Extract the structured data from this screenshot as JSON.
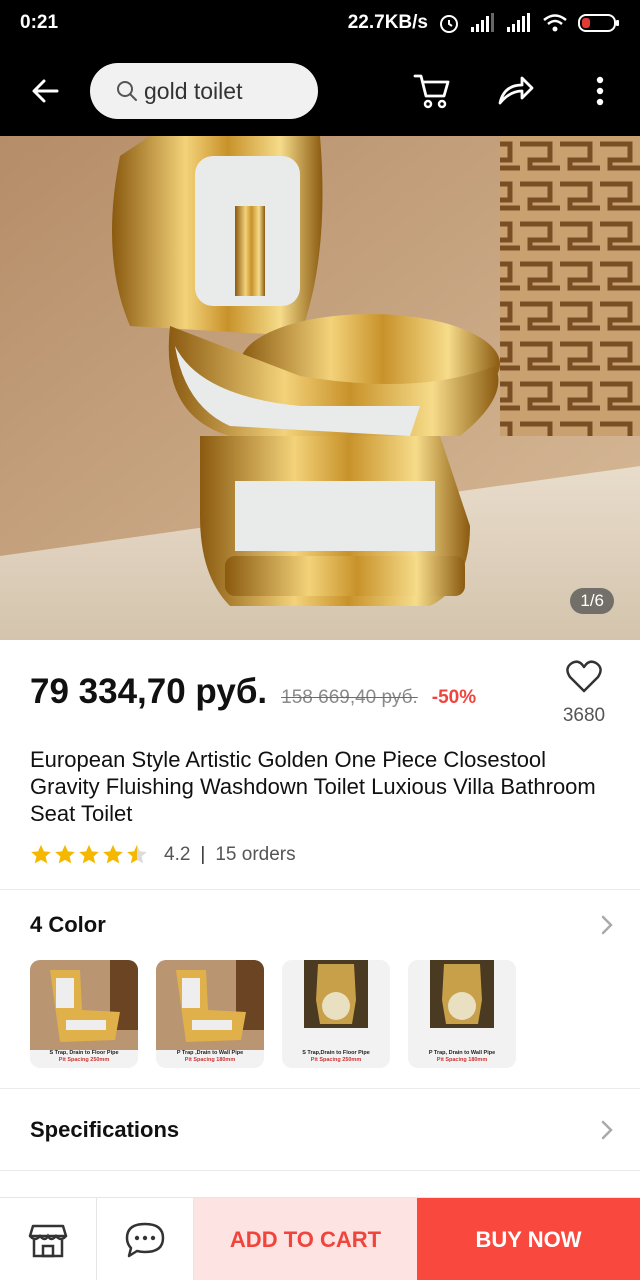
{
  "status_bar": {
    "time": "0:21",
    "network_speed": "22.7KB/s",
    "icons": [
      "alarm-icon",
      "signal-icon",
      "signal-icon",
      "wifi-icon",
      "battery-icon"
    ]
  },
  "header": {
    "search_query": "gold toilet",
    "icons": [
      "back-arrow-icon",
      "search-icon",
      "cart-icon",
      "share-icon",
      "more-vertical-icon"
    ]
  },
  "gallery": {
    "counter": "1/6"
  },
  "product": {
    "price": "79 334,70 руб.",
    "old_price": "158 669,40 руб.",
    "discount": "-50%",
    "wishlist_count": "3680",
    "title": "European Style Artistic Golden One Piece Closestool Gravity Fluishing Washdown Toilet Luxious Villa Bathroom Seat Toilet",
    "rating": 4.2,
    "rating_text": "4.2",
    "orders": "15 orders",
    "colors": {
      "accent": "#f0443c",
      "star": "#f5b800"
    }
  },
  "color_section": {
    "title": "4 Color",
    "options": [
      {
        "line1": "S Trap, Drain to Floor Pipe",
        "line2": "Pit Spacing 250mm"
      },
      {
        "line1": "P Trap ,Drain to Wall Pipe",
        "line2": "Pit Spacing 180mm"
      },
      {
        "line1": "S Trap,Drain to Floor Pipe",
        "line2": "Pit Spacing 250mm"
      },
      {
        "line1": "P Trap, Drain to Wall Pipe",
        "line2": "Pit Spacing 180mm"
      }
    ]
  },
  "specifications": {
    "title": "Specifications"
  },
  "bottom_bar": {
    "add_to_cart": "ADD TO CART",
    "buy_now": "BUY NOW",
    "icons": [
      "store-icon",
      "chat-icon"
    ]
  }
}
